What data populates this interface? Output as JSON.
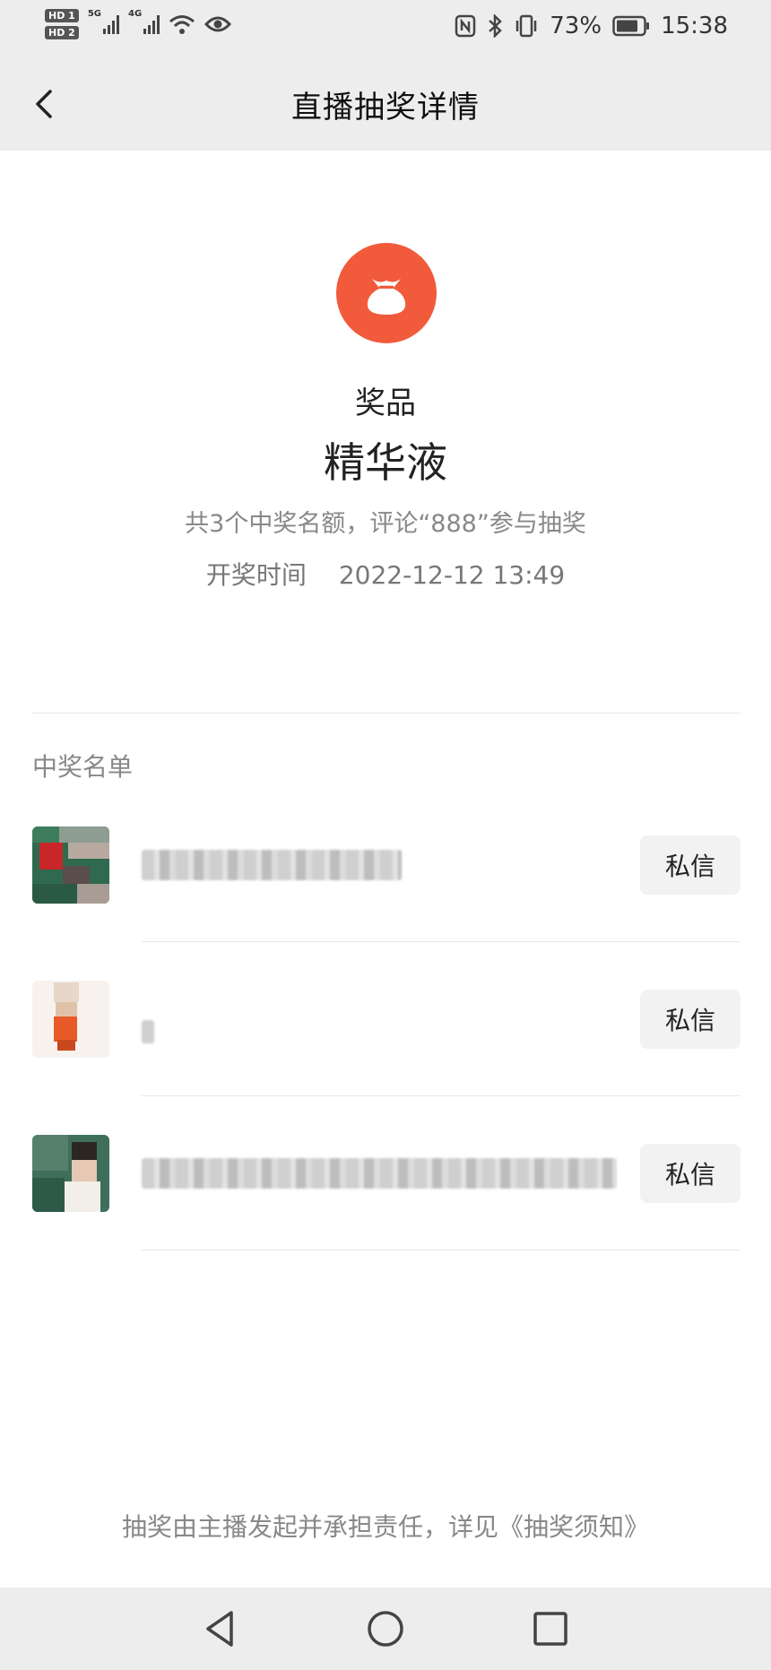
{
  "status_bar": {
    "battery": "73%",
    "time": "15:38",
    "sim_badges": [
      "HD 1",
      "HD 2"
    ],
    "networks": [
      "5G",
      "4G"
    ],
    "icons": [
      "signal-icon",
      "wifi-icon",
      "eye-icon",
      "nfc-icon",
      "bluetooth-icon",
      "vibrate-icon",
      "battery-icon"
    ]
  },
  "header": {
    "title": "直播抽奖详情",
    "back_icon": "chevron-left-icon"
  },
  "prize": {
    "icon": "gift-bag-icon",
    "icon_color": "#f25a3c",
    "label": "奖品",
    "name": "精华液",
    "description": "共3个中奖名额，评论“888”参与抽奖",
    "time_label": "开奖时间",
    "time_value": "2022-12-12 13:49"
  },
  "winners": {
    "title": "中奖名单",
    "items": [
      {
        "button_label": "私信"
      },
      {
        "button_label": "私信"
      },
      {
        "button_label": "私信"
      }
    ]
  },
  "footer": {
    "note": "抽奖由主播发起并承担责任，详见《抽奖须知》"
  },
  "nav_bar": {
    "icons": [
      "nav-back-icon",
      "nav-home-icon",
      "nav-recents-icon"
    ]
  }
}
